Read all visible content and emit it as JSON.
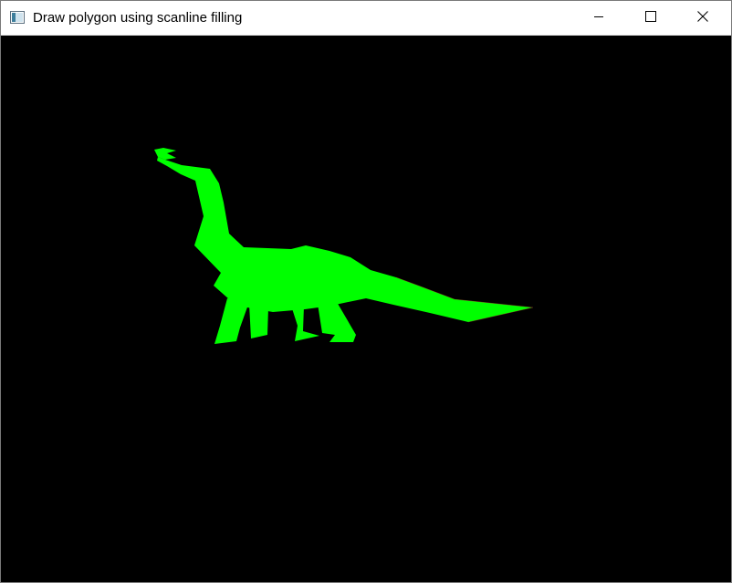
{
  "window": {
    "title": "Draw polygon using scanline filling"
  },
  "canvas": {
    "background": "#000000",
    "fill_color": "#00ff00",
    "edge_color": "#b03030"
  },
  "icons": {
    "app": "app-window-icon",
    "minimize": "minimize-icon",
    "maximize": "maximize-icon",
    "close": "close-icon"
  }
}
